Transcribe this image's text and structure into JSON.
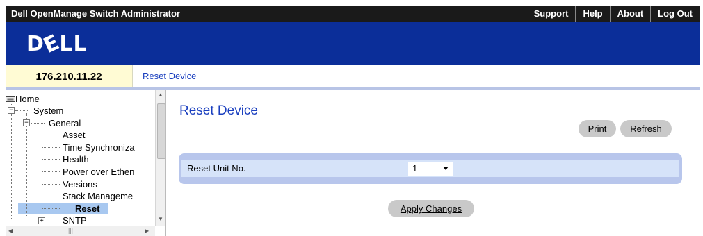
{
  "header": {
    "app_title": "Dell OpenManage Switch Administrator",
    "nav": [
      "Support",
      "Help",
      "About",
      "Log Out"
    ],
    "logo_text": "DELL"
  },
  "ip_address": "176.210.11.22",
  "breadcrumb": "Reset Device",
  "tree": {
    "home": "Home",
    "system": "System",
    "general": "General",
    "items": [
      "Asset",
      "Time Synchroniza",
      "Health",
      "Power over Ethen",
      "Versions",
      "Stack Manageme",
      "Reset"
    ],
    "sntp": "SNTP",
    "selected": "Reset"
  },
  "main": {
    "title": "Reset Device",
    "print_label": "Print",
    "refresh_label": "Refresh",
    "form": {
      "label": "Reset Unit No.",
      "unit_value": "1"
    },
    "apply_label": "Apply Changes"
  },
  "icons": {
    "home": "home-icon",
    "expand": "minus-toggle-icon",
    "collapse": "plus-toggle-icon",
    "dropdown": "chevron-down-icon"
  },
  "colors": {
    "brand_blue": "#0b2e99",
    "link_blue": "#1a3fbf",
    "ip_highlight": "#fffbd4",
    "selection": "#a8c8f0",
    "form_frame": "#b8c6ec",
    "form_row": "#d6e3f9"
  }
}
